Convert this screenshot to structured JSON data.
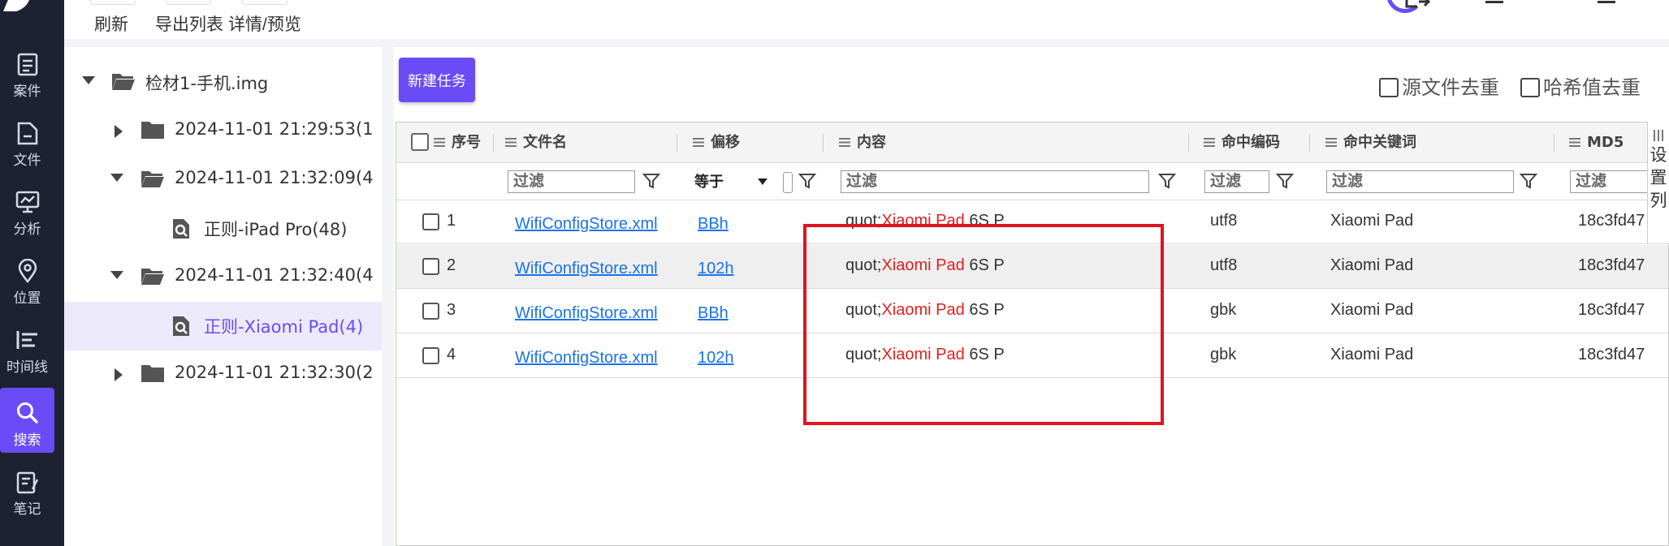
{
  "toolbar": {
    "refresh": "刷新",
    "export_list": "导出列表",
    "details_preview": "详情/预览"
  },
  "rail": {
    "items": [
      {
        "label": "案件",
        "icon": "case-icon"
      },
      {
        "label": "文件",
        "icon": "file-icon"
      },
      {
        "label": "分析",
        "icon": "analysis-icon"
      },
      {
        "label": "位置",
        "icon": "location-icon"
      },
      {
        "label": "时间线",
        "icon": "timeline-icon"
      },
      {
        "label": "搜索",
        "icon": "search-icon",
        "active": true
      },
      {
        "label": "笔记",
        "icon": "notes-icon"
      }
    ]
  },
  "tree": {
    "items": [
      {
        "label": "检材1-手机.img",
        "expanded": true
      },
      {
        "label": "2024-11-01 21:29:53(1",
        "expanded": false
      },
      {
        "label": "2024-11-01 21:32:09(4",
        "expanded": true
      },
      {
        "label": "正则-iPad Pro(48)",
        "leaf": true
      },
      {
        "label": "2024-11-01 21:32:40(4",
        "expanded": true
      },
      {
        "label": "正则-Xiaomi Pad(4)",
        "leaf": true,
        "selected": true
      },
      {
        "label": "2024-11-01 21:32:30(2",
        "expanded": false
      }
    ]
  },
  "main": {
    "new_task": "新建任务",
    "dedup_source": "源文件去重",
    "dedup_hash": "哈希值去重",
    "settings_col": [
      "设",
      "置",
      "列"
    ]
  },
  "grid": {
    "columns": {
      "seq": "序号",
      "filename": "文件名",
      "offset": "偏移",
      "content": "内容",
      "encoding": "命中编码",
      "keyword": "命中关键词",
      "md5": "MD5"
    },
    "filter_placeholder": "过滤",
    "offset_filter_op": "等于",
    "rows": [
      {
        "seq": "1",
        "filename": "WifiConfigStore.xml",
        "offset": "BBh",
        "content_pre": "quot;",
        "content_hit": "Xiaomi Pad",
        "content_post": " 6S P",
        "encoding": "utf8",
        "keyword": "Xiaomi Pad",
        "md5": "18c3fd47"
      },
      {
        "seq": "2",
        "filename": "WifiConfigStore.xml",
        "offset": "102h",
        "content_pre": "quot;",
        "content_hit": "Xiaomi Pad",
        "content_post": " 6S P",
        "encoding": "utf8",
        "keyword": "Xiaomi Pad",
        "md5": "18c3fd47"
      },
      {
        "seq": "3",
        "filename": "WifiConfigStore.xml",
        "offset": "BBh",
        "content_pre": "quot;",
        "content_hit": "Xiaomi Pad",
        "content_post": " 6S P",
        "encoding": "gbk",
        "keyword": "Xiaomi Pad",
        "md5": "18c3fd47"
      },
      {
        "seq": "4",
        "filename": "WifiConfigStore.xml",
        "offset": "102h",
        "content_pre": "quot;",
        "content_hit": "Xiaomi Pad",
        "content_post": " 6S P",
        "encoding": "gbk",
        "keyword": "Xiaomi Pad",
        "md5": "18c3fd47"
      }
    ]
  },
  "colors": {
    "accent": "#6a4cf6",
    "rail_bg": "#1d2233",
    "highlight": "#e02020",
    "annotation_box": "#e0141e",
    "link": "#1a73e8"
  }
}
